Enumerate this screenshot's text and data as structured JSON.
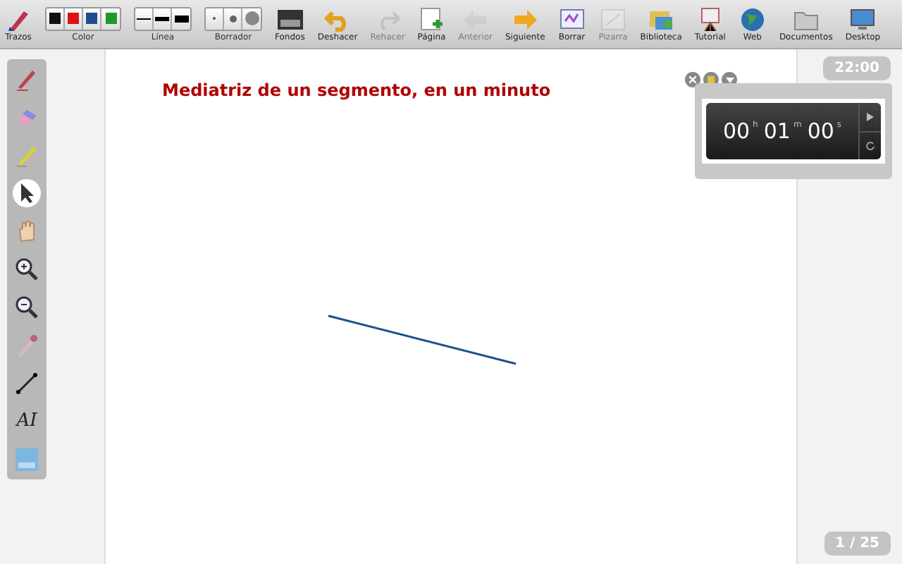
{
  "toolbar": [
    {
      "kind": "pen",
      "label": "Trazos",
      "disabled": false
    },
    {
      "kind": "group",
      "label": "Color",
      "options": [
        {
          "kind": "color",
          "color": "#111111"
        },
        {
          "kind": "color",
          "color": "#e01010"
        },
        {
          "kind": "color",
          "color": "#1d4f8f"
        },
        {
          "kind": "color",
          "color": "#1f9a2a"
        }
      ]
    },
    {
      "kind": "group",
      "label": "Línea",
      "options": [
        {
          "kind": "thin"
        },
        {
          "kind": "medium"
        },
        {
          "kind": "thick"
        }
      ]
    },
    {
      "kind": "group",
      "label": "Borrador",
      "options": [
        {
          "kind": "small"
        },
        {
          "kind": "medium"
        },
        {
          "kind": "large"
        }
      ]
    },
    {
      "kind": "background",
      "label": "Fondos",
      "disabled": false
    },
    {
      "kind": "undo",
      "label": "Deshacer",
      "disabled": false
    },
    {
      "kind": "redo",
      "label": "Rehacer",
      "disabled": true
    },
    {
      "kind": "page",
      "label": "Página",
      "disabled": false
    },
    {
      "kind": "back",
      "label": "Anterior",
      "disabled": true
    },
    {
      "kind": "next",
      "label": "Siguiente",
      "disabled": false
    },
    {
      "kind": "clear",
      "label": "Borrar",
      "disabled": false
    },
    {
      "kind": "board",
      "label": "Pizarra",
      "disabled": true
    },
    {
      "kind": "library",
      "label": "Biblioteca",
      "disabled": false
    },
    {
      "kind": "tutorial",
      "label": "Tutorial",
      "disabled": false
    },
    {
      "kind": "globe",
      "label": "Web",
      "disabled": false
    },
    {
      "kind": "folder",
      "label": "Documentos",
      "disabled": false
    },
    {
      "kind": "monitor",
      "label": "Desktop",
      "disabled": false
    }
  ],
  "sidebar": {
    "tools": [
      {
        "kind": "pen",
        "selected": false
      },
      {
        "kind": "eraser",
        "selected": false
      },
      {
        "kind": "marker",
        "selected": false
      },
      {
        "kind": "pointer",
        "selected": true
      },
      {
        "kind": "hand",
        "selected": false
      },
      {
        "kind": "zoom-in",
        "selected": false
      },
      {
        "kind": "zoom-out",
        "selected": false
      },
      {
        "kind": "laser",
        "selected": false
      },
      {
        "kind": "line",
        "selected": false
      },
      {
        "kind": "text",
        "label": "AI",
        "selected": false
      },
      {
        "kind": "capture",
        "selected": false
      }
    ]
  },
  "page": {
    "title": "Mediatriz de un segmento, en un minuto",
    "page_number": "1 / 25"
  },
  "clock": "22:00",
  "timer": {
    "hours": "00",
    "hours_unit": "h",
    "minutes": "01",
    "minutes_unit": "m",
    "seconds": "00",
    "seconds_unit": "s"
  }
}
